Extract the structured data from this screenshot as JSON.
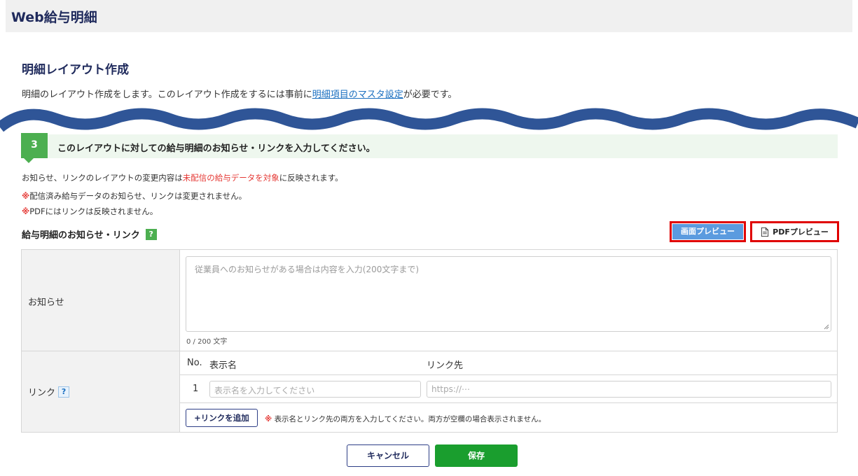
{
  "header": {
    "app_title": "Web給与明細"
  },
  "page": {
    "title": "明細レイアウト作成",
    "desc_prefix": "明細のレイアウト作成をします。このレイアウト作成をするには事前に",
    "desc_link": "明細項目のマスタ設定",
    "desc_suffix": "が必要です。"
  },
  "step": {
    "number": "3",
    "text": "このレイアウトに対しての給与明細のお知らせ・リンクを入力してください。"
  },
  "notes": {
    "line1_prefix": "お知らせ、リンクのレイアウトの変更内容は",
    "line1_highlight": "未配信の給与データを対象",
    "line1_suffix": "に反映されます。",
    "mark": "※",
    "line2": "配信済み給与データのお知らせ、リンクは変更されません。",
    "line3": "PDFにはリンクは反映されません。"
  },
  "section": {
    "title": "給与明細のお知らせ・リンク",
    "help": "?",
    "preview_screen": "画面プレビュー",
    "preview_pdf": "PDFプレビュー"
  },
  "form": {
    "notice_label": "お知らせ",
    "notice_placeholder": "従業員へのお知らせがある場合は内容を入力(200文字まで)",
    "counter": "0 / 200 文字",
    "link_label": "リンク",
    "col_no": "No.",
    "col_name": "表示名",
    "col_url": "リンク先",
    "rows": [
      {
        "no": "1",
        "name_placeholder": "表示名を入力してください",
        "url_placeholder": "https://⋯"
      }
    ],
    "add_button": "+リンクを追加",
    "add_note": "表示名とリンク先の両方を入力してください。両方が空欄の場合表示されません。"
  },
  "footer": {
    "cancel": "キャンセル",
    "save": "保存"
  },
  "colors": {
    "accent_green": "#4caf50",
    "navy": "#1f2a5c",
    "save_green": "#1a9e2e",
    "preview_blue": "#5b9bdf",
    "highlight_red": "#e00000"
  }
}
